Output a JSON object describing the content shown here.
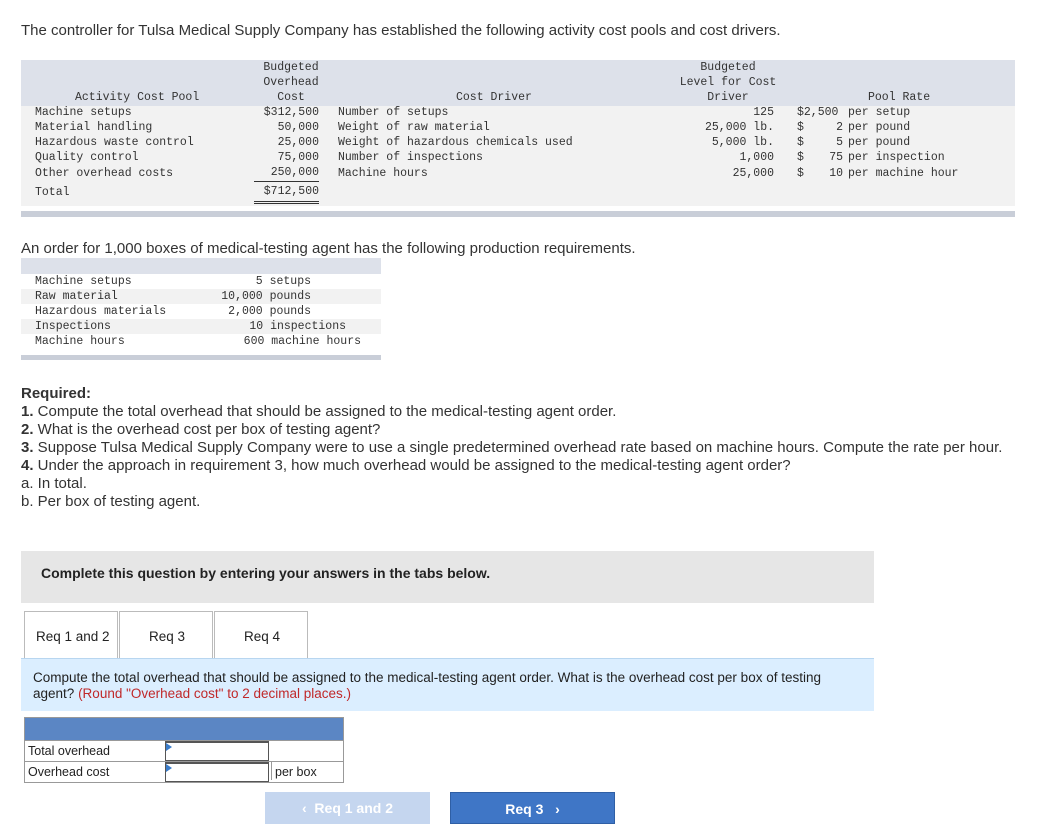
{
  "intro": "The controller for Tulsa Medical Supply Company has established the following activity cost pools and cost drivers.",
  "cost_table": {
    "headers": {
      "pool": "Activity Cost Pool",
      "overhead_l1": "Budgeted",
      "overhead_l2": "Overhead",
      "overhead_l3": "Cost",
      "driver": "Cost Driver",
      "level_l1": "Budgeted",
      "level_l2": "Level for Cost",
      "level_l3": "Driver",
      "rate": "Pool Rate"
    },
    "rows": [
      {
        "pool": "Machine setups",
        "cost": "$312,500",
        "driver": "Number of setups",
        "level": "125",
        "rate_sym": "$2,500",
        "rate_unit": "per setup"
      },
      {
        "pool": "Material handling",
        "cost": "50,000",
        "driver": "Weight of raw material",
        "level": "25,000 lb.",
        "rate_sym": "$",
        "rate_num": "2",
        "rate_unit": "per pound"
      },
      {
        "pool": "Hazardous waste control",
        "cost": "25,000",
        "driver": "Weight of hazardous chemicals used",
        "level": "5,000 lb.",
        "rate_sym": "$",
        "rate_num": "5",
        "rate_unit": "per pound"
      },
      {
        "pool": "Quality control",
        "cost": "75,000",
        "driver": "Number of inspections",
        "level": "1,000",
        "rate_sym": "$",
        "rate_num": "75",
        "rate_unit": "per inspection"
      },
      {
        "pool": "Other overhead costs",
        "cost": "250,000",
        "driver": "Machine hours",
        "level": "25,000",
        "rate_sym": "$",
        "rate_num": "10",
        "rate_unit": "per machine hour"
      }
    ],
    "total_label": "Total",
    "total_cost": "$712,500"
  },
  "intro2": "An order for 1,000 boxes of medical-testing agent has the following production requirements.",
  "requirements": [
    {
      "label": "Machine setups",
      "value": "5 setups"
    },
    {
      "label": "Raw material",
      "value": "10,000 pounds"
    },
    {
      "label": "Hazardous materials",
      "value": "2,000 pounds"
    },
    {
      "label": "Inspections",
      "value": "10 inspections"
    },
    {
      "label": "Machine hours",
      "value": "600 machine hours"
    }
  ],
  "required": {
    "title": "Required:",
    "n1": "1.",
    "l1": " Compute the total overhead that should be assigned to the medical-testing agent order.",
    "n2": "2.",
    "l2": " What is the overhead cost per box of testing agent?",
    "n3": "3.",
    "l3": " Suppose Tulsa Medical Supply Company were to use a single predetermined overhead rate based on machine hours. Compute the rate per hour.",
    "n4": "4.",
    "l4": " Under the approach in requirement 3, how much overhead would be assigned to the medical-testing agent order?",
    "la": "a. In total.",
    "lb": "b. Per box of testing agent."
  },
  "complete_text": "Complete this question by entering your answers in the tabs below.",
  "tabs": [
    {
      "label": "Req 1 and 2"
    },
    {
      "label": "Req 3"
    },
    {
      "label": "Req 4"
    }
  ],
  "question": {
    "text": "Compute the total overhead that should be assigned to the medical-testing agent order. What is the overhead cost per box of testing agent?",
    "note": "(Round \"Overhead cost\" to 2 decimal places.)"
  },
  "answers": {
    "total_label": "Total overhead",
    "total_value": "",
    "cost_label": "Overhead cost",
    "cost_value": "",
    "cost_unit": "per box"
  },
  "nav": {
    "prev": "Req 1 and 2",
    "next": "Req 3"
  },
  "colors": {
    "header_bg": "#dde1ea",
    "accent": "#3f76c6",
    "question_bg": "#dbeeff"
  }
}
